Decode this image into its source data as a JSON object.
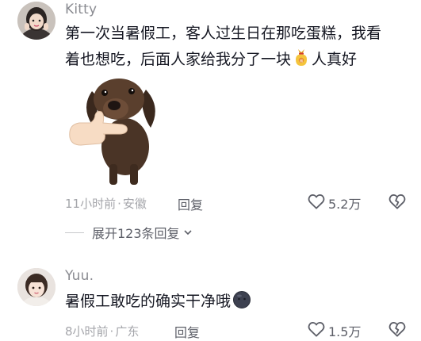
{
  "comments": [
    {
      "username": "Kitty",
      "text_line1": "第一次当暑假工，客人过生日在那吃蛋糕，我看",
      "text_line2_before": "着也想吃，后面人家给我分了一块",
      "text_line2_after": "人真好",
      "inline_emoji_icon": "blessing-bag-icon",
      "sticker_icon": "dachshund-pointing-sticker",
      "time": "11小时前",
      "location": "安徽",
      "separator": "·",
      "reply_label": "回复",
      "like_count": "5.2万",
      "expand_replies_label": "展开123条回复"
    },
    {
      "username": "Yuu.",
      "text_before": "暑假工敢吃的确实干净哦",
      "inline_emoji_icon": "dark-face-emoji-icon",
      "time": "8小时前",
      "location": "广东",
      "separator": "·",
      "reply_label": "回复",
      "like_count": "1.5万"
    }
  ],
  "colors": {
    "text_primary": "#161823",
    "text_secondary": "#8a8b91",
    "text_meta": "#a5a6ab",
    "action": "#5d5f68"
  }
}
